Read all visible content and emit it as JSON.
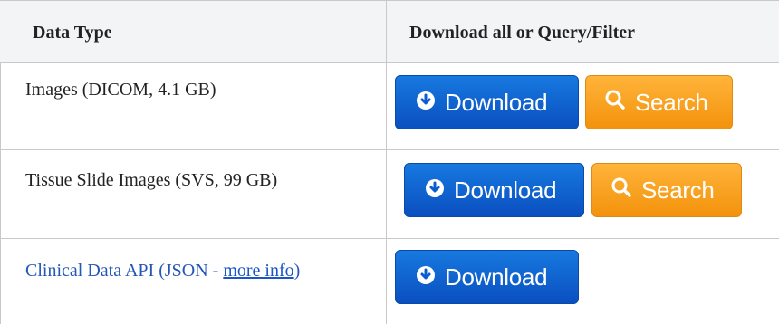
{
  "table": {
    "headers": [
      "Data Type",
      "Download all or Query/Filter"
    ],
    "rows": [
      {
        "type_label": "Images (DICOM, 4.1 GB)",
        "buttons": [
          "Download",
          "Search"
        ]
      },
      {
        "type_label": "Tissue Slide Images (SVS, 99 GB)",
        "buttons": [
          "Download",
          "Search"
        ]
      },
      {
        "type_prefix": "Clinical Data API (JSON - ",
        "link_text": "more info",
        "type_suffix": ")",
        "buttons": [
          "Download"
        ]
      }
    ]
  },
  "buttons": {
    "download_label": "Download",
    "search_label": "Search",
    "download_color": "#0a5cd0",
    "search_color": "#f7a01e"
  }
}
